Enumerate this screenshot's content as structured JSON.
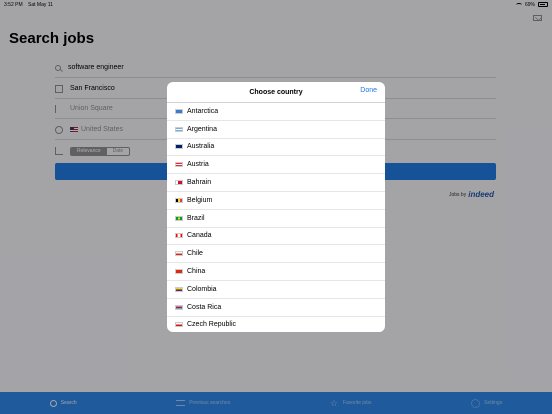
{
  "status_bar": {
    "time": "3:52 PM",
    "date": "Sat May 11",
    "battery": "69%"
  },
  "search": {
    "title": "Search jobs",
    "what_value": "software engineer",
    "where_value": "San Francisco",
    "near_placeholder": "Union Square",
    "country_value": "United States",
    "sort_options": [
      "Relevance",
      "Date"
    ],
    "sort_selected": "Relevance",
    "jobs_by": "Jobs by",
    "brand": "indeed"
  },
  "modal": {
    "title": "Choose country",
    "done_label": "Done",
    "countries": [
      {
        "name": "Antarctica",
        "flag": "aq"
      },
      {
        "name": "Argentina",
        "flag": "ar"
      },
      {
        "name": "Australia",
        "flag": "au"
      },
      {
        "name": "Austria",
        "flag": "at"
      },
      {
        "name": "Bahrain",
        "flag": "bh"
      },
      {
        "name": "Belgium",
        "flag": "be"
      },
      {
        "name": "Brazil",
        "flag": "br"
      },
      {
        "name": "Canada",
        "flag": "ca"
      },
      {
        "name": "Chile",
        "flag": "cl"
      },
      {
        "name": "China",
        "flag": "cn"
      },
      {
        "name": "Colombia",
        "flag": "co"
      },
      {
        "name": "Costa Rica",
        "flag": "cr"
      },
      {
        "name": "Czech Republic",
        "flag": "cz"
      }
    ]
  },
  "tabbar": {
    "items": [
      {
        "label": "Search",
        "icon": "search-icon"
      },
      {
        "label": "Previous searches",
        "icon": "list-icon"
      },
      {
        "label": "Favorite jobs",
        "icon": "star-icon"
      },
      {
        "label": "Settings",
        "icon": "gear-icon"
      }
    ]
  },
  "colors": {
    "accent": "#1f7ae0",
    "tabbar": "#2f86e6"
  }
}
